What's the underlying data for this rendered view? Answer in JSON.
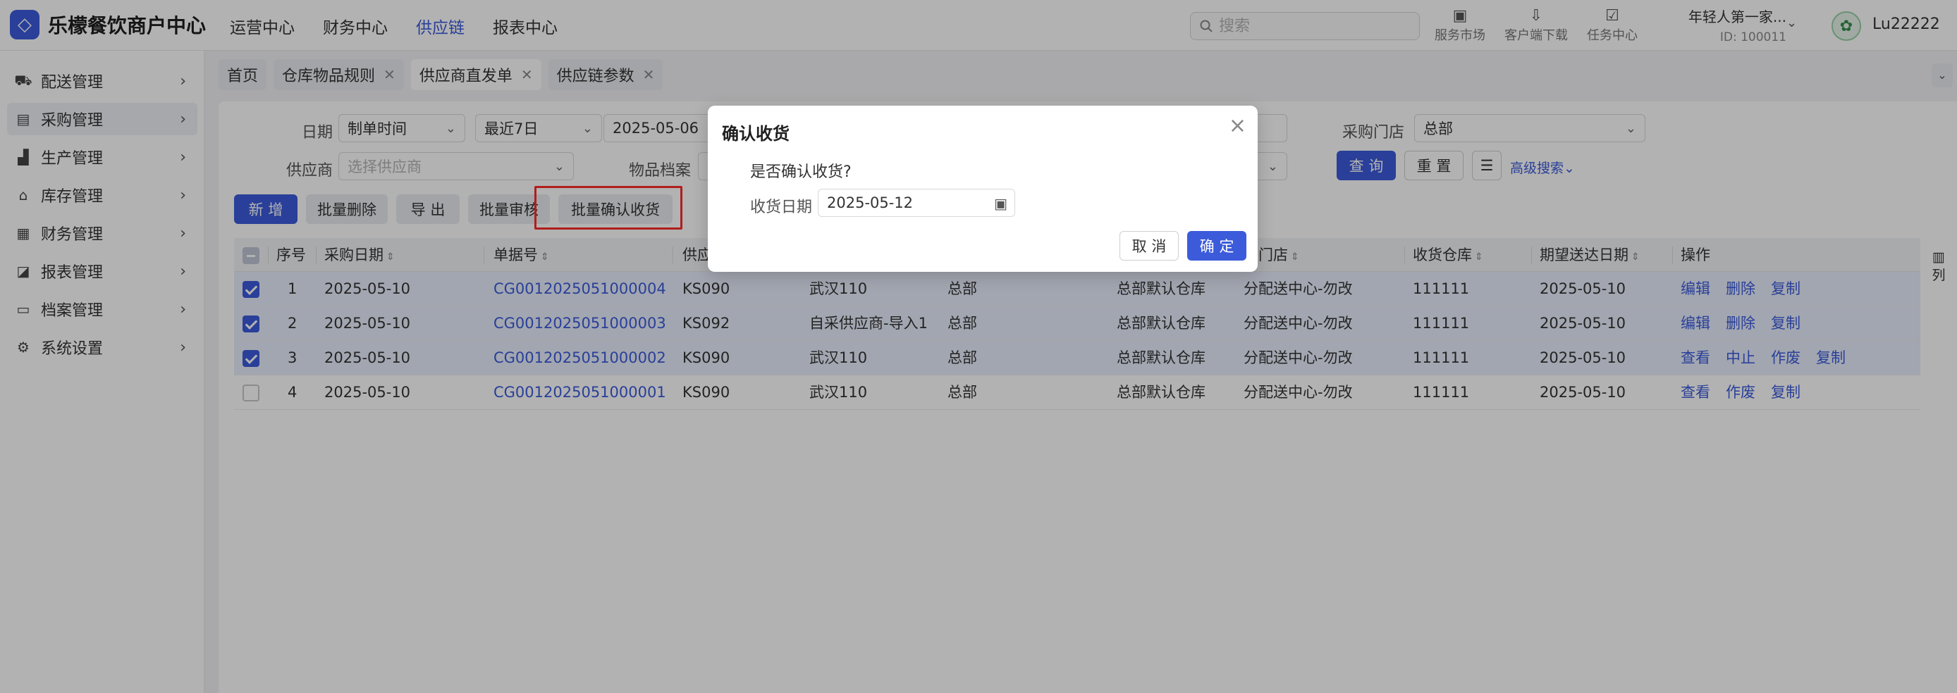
{
  "brand": {
    "name": "乐檬餐饮商户中心",
    "logo_icon": "brand-logo-icon"
  },
  "topnav": {
    "items": [
      {
        "label": "运营中心",
        "active": false
      },
      {
        "label": "财务中心",
        "active": false
      },
      {
        "label": "供应链",
        "active": true
      },
      {
        "label": "报表中心",
        "active": false
      }
    ]
  },
  "search": {
    "placeholder": "搜索",
    "value": ""
  },
  "tools": [
    {
      "icon": "shopping-bag-icon",
      "label": "服务市场"
    },
    {
      "icon": "folder-download-icon",
      "label": "客户端下载"
    },
    {
      "icon": "clipboard-check-icon",
      "label": "任务中心"
    }
  ],
  "store": {
    "name": "年轻人第一家...",
    "id": "ID: 100011"
  },
  "user": {
    "name": "Lu22222"
  },
  "sidebar": {
    "items": [
      {
        "icon": "truck-icon",
        "label": "配送管理",
        "active": false
      },
      {
        "icon": "cart-icon",
        "label": "采购管理",
        "active": true
      },
      {
        "icon": "factory-icon",
        "label": "生产管理",
        "active": false
      },
      {
        "icon": "warehouse-icon",
        "label": "库存管理",
        "active": false
      },
      {
        "icon": "ledger-icon",
        "label": "财务管理",
        "active": false
      },
      {
        "icon": "report-icon",
        "label": "报表管理",
        "active": false
      },
      {
        "icon": "archive-icon",
        "label": "档案管理",
        "active": false
      },
      {
        "icon": "gear-icon",
        "label": "系统设置",
        "active": false
      }
    ]
  },
  "tabs": [
    {
      "label": "首页",
      "closable": false,
      "active": false
    },
    {
      "label": "仓库物品规则",
      "closable": true,
      "active": false
    },
    {
      "label": "供应商直发单",
      "closable": true,
      "active": true
    },
    {
      "label": "供应链参数",
      "closable": true,
      "active": false
    }
  ],
  "filters": {
    "date_label": "日期",
    "date_type": "制单时间",
    "date_range": "最近7日",
    "date_start": "2025-05-06",
    "store_label": "采购门店",
    "store_value": "总部",
    "supplier_label": "供应商",
    "supplier_placeholder": "选择供应商",
    "item_label": "物品档案",
    "query_btn": "查 询",
    "reset_btn": "重 置",
    "advanced_link": "高级搜索"
  },
  "actions": {
    "add": "新 增",
    "batch_delete": "批量删除",
    "export": "导 出",
    "batch_audit": "批量审核",
    "batch_confirm": "批量确认收货"
  },
  "table": {
    "headers": {
      "seq": "序号",
      "purchase_date": "采购日期",
      "doc_no": "单据号",
      "supplier_code": "供应",
      "supply_store": "货门店",
      "recv_warehouse": "收货仓库",
      "expect_date": "期望送达日期",
      "ops": "操作"
    },
    "rows": [
      {
        "selected": true,
        "seq": "1",
        "date": "2025-05-10",
        "doc": "CG0012025051000004",
        "code": "KS090",
        "supplier": "武汉110",
        "org": "总部",
        "warehouse": "总部默认仓库",
        "store": "分配送中心-勿改",
        "recv": "111111",
        "expect": "2025-05-10",
        "ops": [
          "编辑",
          "删除",
          "复制"
        ]
      },
      {
        "selected": true,
        "seq": "2",
        "date": "2025-05-10",
        "doc": "CG0012025051000003",
        "code": "KS092",
        "supplier": "自采供应商-导入1",
        "org": "总部",
        "warehouse": "总部默认仓库",
        "store": "分配送中心-勿改",
        "recv": "111111",
        "expect": "2025-05-10",
        "ops": [
          "编辑",
          "删除",
          "复制"
        ]
      },
      {
        "selected": true,
        "seq": "3",
        "date": "2025-05-10",
        "doc": "CG0012025051000002",
        "code": "KS090",
        "supplier": "武汉110",
        "org": "总部",
        "warehouse": "总部默认仓库",
        "store": "分配送中心-勿改",
        "recv": "111111",
        "expect": "2025-05-10",
        "ops": [
          "查看",
          "中止",
          "作废",
          "复制"
        ]
      },
      {
        "selected": false,
        "seq": "4",
        "date": "2025-05-10",
        "doc": "CG0012025051000001",
        "code": "KS090",
        "supplier": "武汉110",
        "org": "总部",
        "warehouse": "总部默认仓库",
        "store": "分配送中心-勿改",
        "recv": "111111",
        "expect": "2025-05-10",
        "ops": [
          "查看",
          "作废",
          "复制"
        ]
      }
    ],
    "column_settings_label": "列"
  },
  "modal": {
    "title": "确认收货",
    "question": "是否确认收货?",
    "date_label": "收货日期",
    "date_value": "2025-05-12",
    "cancel": "取 消",
    "ok": "确 定"
  },
  "colors": {
    "primary": "#3b5bdb",
    "highlight": "#ff2a2a"
  }
}
